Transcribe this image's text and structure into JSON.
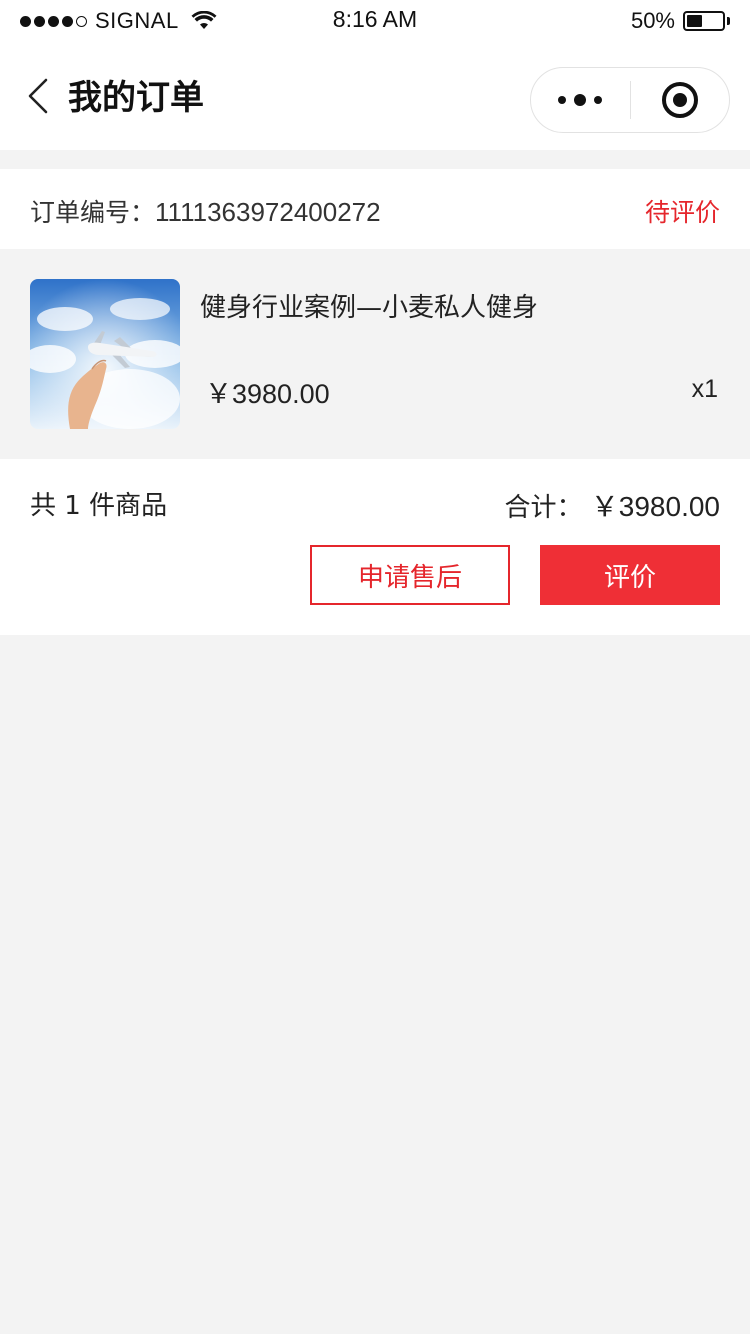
{
  "status_bar": {
    "carrier": "SIGNAL",
    "time": "8:16 AM",
    "battery_percent": "50%",
    "battery_level": 0.5
  },
  "nav": {
    "title": "我的订单",
    "back_icon": "chevron-left-icon",
    "more_icon": "more-dots-icon",
    "close_icon": "target-close-icon"
  },
  "order": {
    "number_label": "订单编号：",
    "number": "1111363972400272",
    "status": "待评价",
    "product": {
      "title": "健身行业案例—小麦私人健身",
      "price": "￥3980.00",
      "quantity": "x1"
    },
    "summary": {
      "count_text": "共 1 件商品",
      "total_label": "合计：",
      "total_amount": "￥3980.00"
    },
    "actions": {
      "aftersale_label": "申请售后",
      "review_label": "评价"
    }
  },
  "colors": {
    "accent": "#e5262c",
    "button_fill": "#ef2f36",
    "page_bg": "#f3f3f3"
  }
}
